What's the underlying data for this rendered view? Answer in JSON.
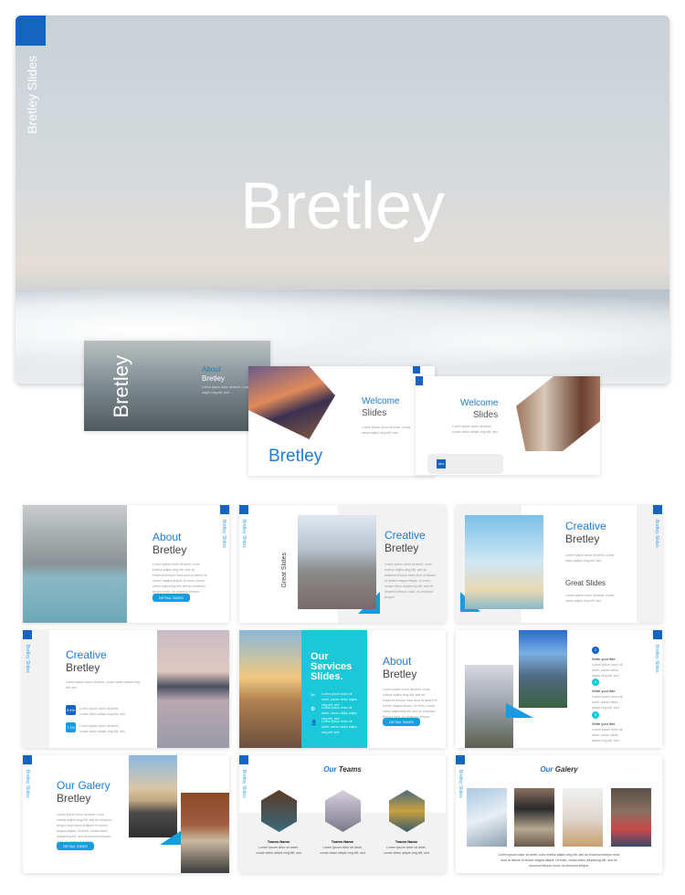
{
  "brand": "Bretley Slides",
  "hero": {
    "title": "Bretley"
  },
  "colors": {
    "accent": "#1e7ad2",
    "dark_blue": "#1565c0",
    "cyan": "#1ac8d8"
  },
  "lorem": "Lorem ipsum dolor sit amet, cons ectetur adipis cing elit, sed do eiusmod tempor incid dunt ut labore et dolore magna aliqua. Ut enim, conse ctetur adipiscing elit, sed do eiusmod tempor incid, do eiusmod tempor",
  "lorem_short": "Lorem ipsum dolor sit amet, conse ctetur adipis cing elit, sed",
  "preview": {
    "about": {
      "title": "About",
      "subtitle": "Bretley",
      "vertical": "Bretley"
    },
    "cover": {
      "title": "Bretley"
    },
    "welcome1": {
      "title": "Welcome",
      "subtitle": "Slides"
    },
    "welcome2": {
      "title": "Welcome",
      "subtitle": "Slides",
      "badge": "99%"
    }
  },
  "slides": [
    {
      "title": "About",
      "subtitle": "Bretley",
      "button": "DETAIL SIDES"
    },
    {
      "title": "Creative",
      "subtitle": "Bretley",
      "vertical": "Great Slides"
    },
    {
      "title": "Creative",
      "subtitle": "Bretley",
      "heading": "Great Slides"
    },
    {
      "title": "Creative",
      "subtitle": "Bretley",
      "stats": [
        "5.4%",
        "7.1%"
      ]
    },
    {
      "title": "Our Services Slides.",
      "about_title": "About",
      "about_subtitle": "Bretley",
      "button": "DETAIL SIDES"
    },
    {
      "items": [
        {
          "num": "1",
          "title": "Write your title"
        },
        {
          "num": "2",
          "title": "Write your title"
        },
        {
          "num": "3",
          "title": "Write your title"
        }
      ]
    },
    {
      "title": "Our Galery",
      "subtitle": "Bretley",
      "button": "DETAIL SIDES"
    },
    {
      "title_a": "Our",
      "title_b": "Teams",
      "members": [
        {
          "name": "Teams Name"
        },
        {
          "name": "Teams Name"
        },
        {
          "name": "Teams Name"
        }
      ]
    },
    {
      "title_a": "Our",
      "title_b": "Galery"
    }
  ]
}
